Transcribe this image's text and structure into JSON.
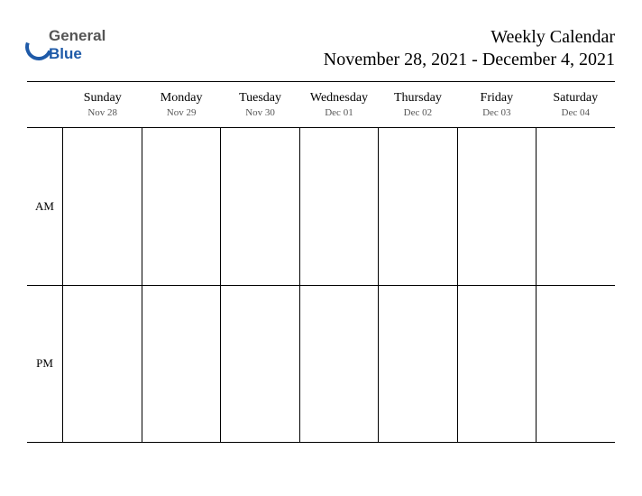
{
  "logo": {
    "part1": "General",
    "part2": "Blue"
  },
  "title": {
    "line1": "Weekly Calendar",
    "line2": "November 28, 2021 - December 4, 2021"
  },
  "periods": [
    "AM",
    "PM"
  ],
  "days": [
    {
      "name": "Sunday",
      "date": "Nov 28"
    },
    {
      "name": "Monday",
      "date": "Nov 29"
    },
    {
      "name": "Tuesday",
      "date": "Nov 30"
    },
    {
      "name": "Wednesday",
      "date": "Dec 01"
    },
    {
      "name": "Thursday",
      "date": "Dec 02"
    },
    {
      "name": "Friday",
      "date": "Dec 03"
    },
    {
      "name": "Saturday",
      "date": "Dec 04"
    }
  ]
}
